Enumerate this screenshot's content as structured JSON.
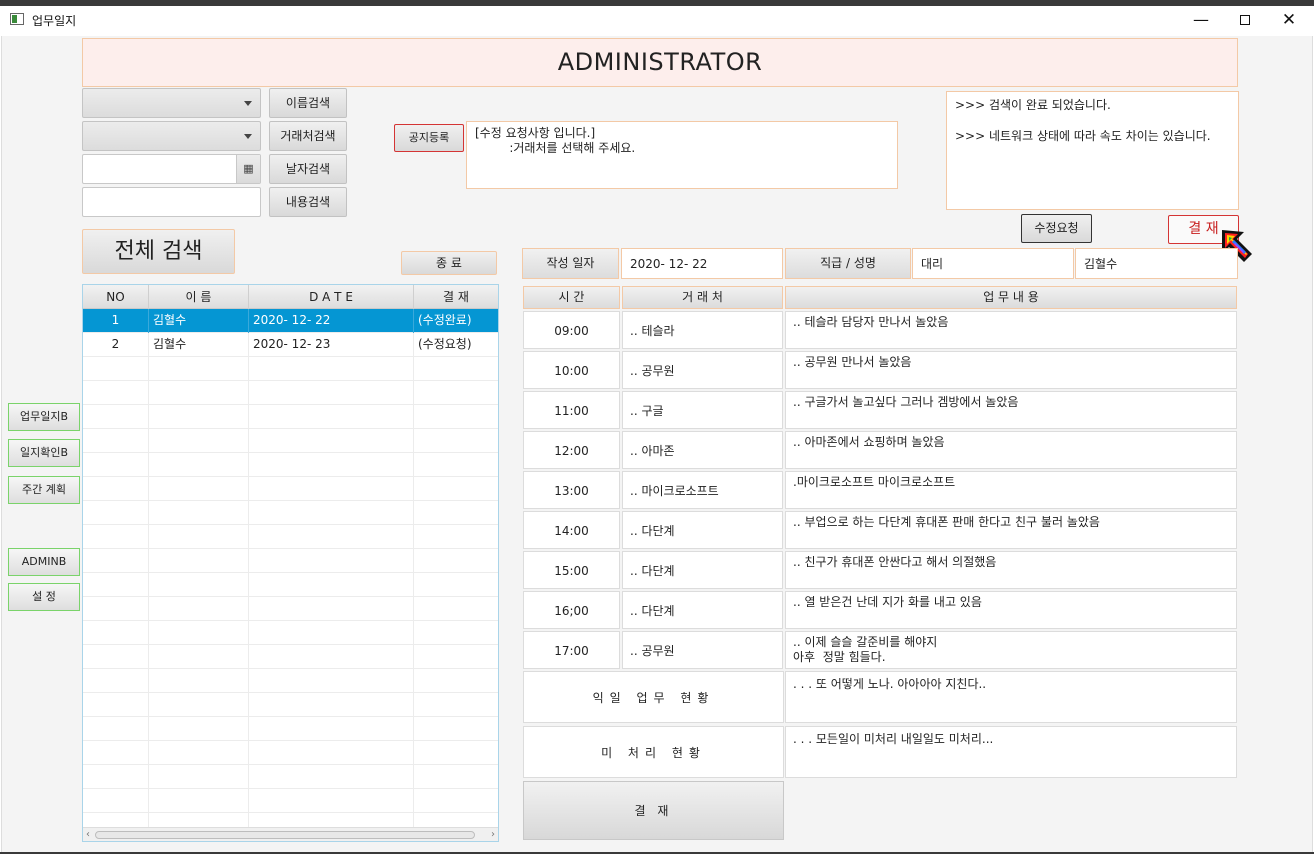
{
  "window": {
    "title": "업무일지",
    "minimize": "—",
    "close": "✕"
  },
  "header": {
    "title": "ADMINISTRATOR"
  },
  "search": {
    "name_search": "이름검색",
    "client_search": "거래처검색",
    "date_search": "날자검색",
    "content_search": "내용검색",
    "date_icon": "▦",
    "full_search": "전체 검색",
    "exit": "종 료"
  },
  "notice": {
    "register_button": "공지등록",
    "text": "[수정 요청사항 입니다.]\n         :거래처를 선택해 주세요."
  },
  "messages": [
    ">>> 검색이 완료 되었습니다.",
    ">>> 네트워크 상태에 따라 속도 차이는 있습니다."
  ],
  "actions": {
    "revision_request": "수정요청",
    "approve": "결 재"
  },
  "sidebar": {
    "items": [
      "업무일지B",
      "일지확인B",
      "주간 계획",
      "ADMINB",
      "설   정"
    ]
  },
  "table": {
    "headers": [
      "NO",
      "이      름",
      "D     A     T     E",
      "결   재"
    ],
    "rows": [
      {
        "no": "1",
        "name": "김혈수",
        "date": "2020- 12- 22",
        "status": "(수정완료)"
      },
      {
        "no": "2",
        "name": "김혈수",
        "date": "2020- 12- 23",
        "status": "(수정요청)"
      }
    ],
    "scroll_left": "‹",
    "scroll_right": "›"
  },
  "info": {
    "date_label": "작성 일자",
    "date_value": "2020- 12- 22",
    "rank_label": "직급 / 성명",
    "rank_value": "대리",
    "name_value": "김혈수"
  },
  "schedule": {
    "headers": [
      "시   간",
      "거  래  처",
      "업          무          내          용"
    ],
    "rows": [
      {
        "time": "09:00",
        "client": ".. 테슬라",
        "work": ".. 테슬라 담당자 만나서 놀았음"
      },
      {
        "time": "10:00",
        "client": ".. 공무원",
        "work": ".. 공무원 만나서 놀았음"
      },
      {
        "time": "11:00",
        "client": ".. 구글",
        "work": ".. 구글가서 놀고싶다 그러나 겜방에서 놀았음"
      },
      {
        "time": "12:00",
        "client": ".. 아마존",
        "work": ".. 아마존에서 쇼핑하며 놀았음"
      },
      {
        "time": "13:00",
        "client": ".. 마이크로소프트",
        "work": ".마이크로소프트 마이크로소프트"
      },
      {
        "time": "14:00",
        "client": ".. 다단계",
        "work": ".. 부업으로 하는 다단계 휴대폰 판매 한다고 친구 불러 놀았음"
      },
      {
        "time": "15:00",
        "client": ".. 다단계",
        "work": ".. 친구가 휴대폰 안싼다고 해서 의절했음"
      },
      {
        "time": "16;00",
        "client": ".. 다단계",
        "work": ".. 열 받은건 난데 지가 화를 내고 있음"
      },
      {
        "time": "17:00",
        "client": ".. 공무원",
        "work": ".. 이제 슬슬 갈준비를 해야지\n아후  정말 힘들다."
      }
    ],
    "tomorrow_label": "익일 업무 현황",
    "tomorrow_text": ". . . 또 어떻게 노나. 아아아아 지친다..",
    "pending_label": "미 처리   현황",
    "pending_text": ". . . 모든일이 미처리 내일일도 미처리...",
    "approve_button": "결 재"
  }
}
